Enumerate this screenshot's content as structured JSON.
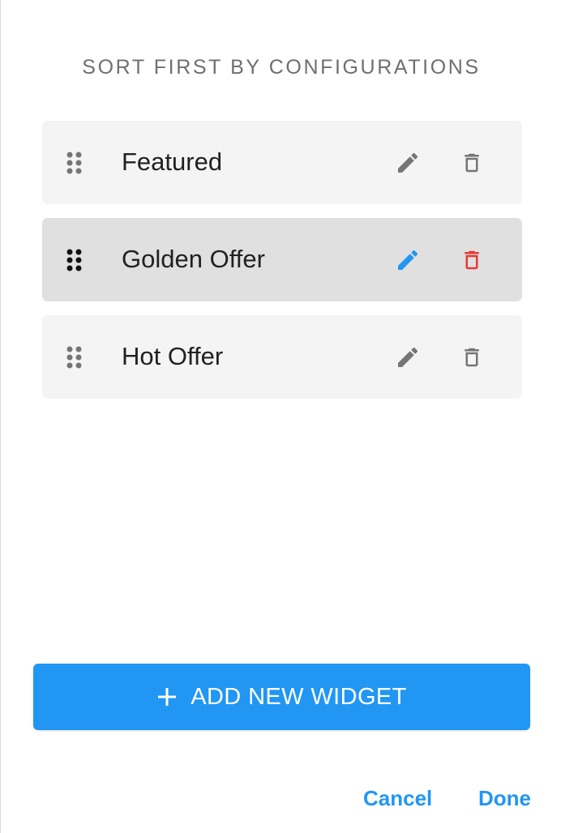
{
  "dialog": {
    "title": "SORT FIRST BY CONFIGURATIONS"
  },
  "items": [
    {
      "label": "Featured",
      "active": false
    },
    {
      "label": "Golden Offer",
      "active": true
    },
    {
      "label": "Hot Offer",
      "active": false
    }
  ],
  "icons": {
    "drag": "drag-handle-icon",
    "edit": "pencil-icon",
    "delete": "trash-icon",
    "add": "plus-icon"
  },
  "colors": {
    "accent": "#2196f3",
    "danger": "#e53935",
    "icon_default": "#757575",
    "row_bg": "#f4f4f4",
    "row_active_bg": "#e0e0e0"
  },
  "actions": {
    "add_label": "ADD NEW WIDGET",
    "cancel_label": "Cancel",
    "done_label": "Done"
  }
}
